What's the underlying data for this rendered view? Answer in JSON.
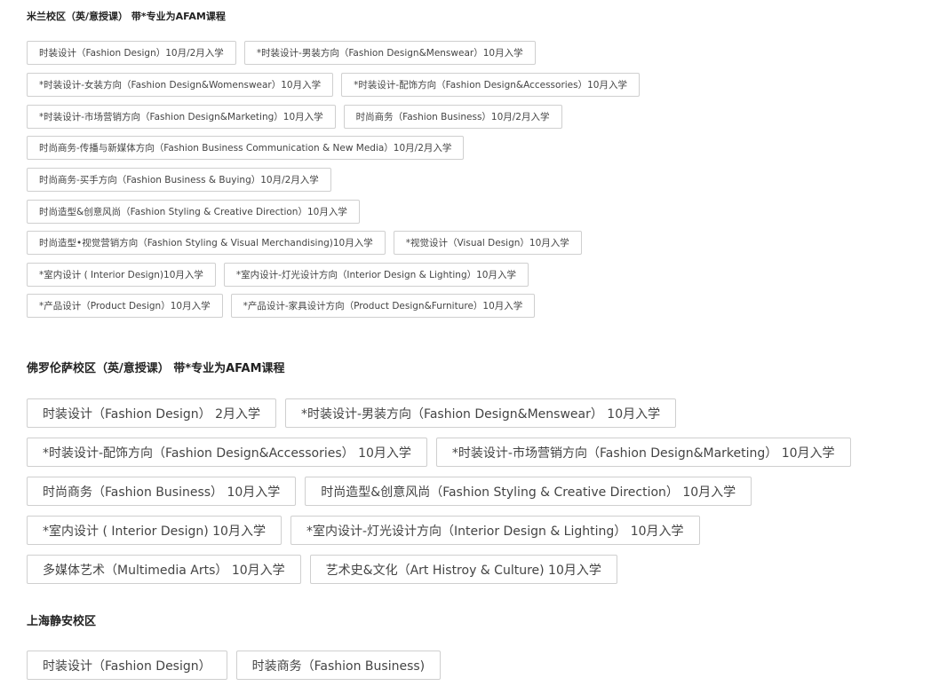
{
  "sections": [
    {
      "title": "米兰校区（英/意授课） 带*专业为AFAM课程",
      "rows": [
        [
          "时装设计（Fashion Design）10月/2月入学",
          "*时装设计-男装方向（Fashion Design&Menswear）10月入学"
        ],
        [
          "*时装设计-女装方向（Fashion Design&Womenswear）10月入学",
          "*时装设计-配饰方向（Fashion Design&Accessories）10月入学"
        ],
        [
          "*时装设计-市场营销方向（Fashion Design&Marketing）10月入学",
          "时尚商务（Fashion Business）10月/2月入学"
        ],
        [
          "时尚商务-传播与新媒体方向（Fashion Business Communication & New Media）10月/2月入学"
        ],
        [
          "时尚商务-买手方向（Fashion Business & Buying）10月/2月入学"
        ],
        [
          "时尚造型&创意风尚（Fashion Styling & Creative Direction）10月入学"
        ],
        [
          "时尚造型•视觉营销方向（Fashion Styling & Visual Merchandising)10月入学",
          "*视觉设计（Visual Design）10月入学"
        ],
        [
          "*室内设计 ( Interior Design)10月入学",
          "*室内设计-灯光设计方向（Interior Design & Lighting）10月入学"
        ],
        [
          "*产品设计（Product Design）10月入学",
          "*产品设计-家具设计方向（Product Design&Furniture）10月入学"
        ]
      ]
    },
    {
      "title": "佛罗伦萨校区（英/意授课） 带*专业为AFAM课程",
      "rows": [
        [
          "时装设计（Fashion Design） 2月入学",
          "*时装设计-男装方向（Fashion Design&Menswear） 10月入学"
        ],
        [
          "*时装设计-配饰方向（Fashion Design&Accessories） 10月入学",
          "*时装设计-市场营销方向（Fashion Design&Marketing） 10月入学"
        ],
        [
          "时尚商务（Fashion Business） 10月入学",
          "时尚造型&创意风尚（Fashion Styling & Creative Direction） 10月入学"
        ],
        [
          "*室内设计 ( Interior Design) 10月入学",
          "*室内设计-灯光设计方向（Interior Design & Lighting） 10月入学"
        ],
        [
          "多媒体艺术（Multimedia Arts） 10月入学",
          "艺术史&文化（Art Histroy & Culture) 10月入学"
        ]
      ]
    },
    {
      "title": "上海静安校区",
      "rows": [
        [
          "时装设计（Fashion Design）",
          "时装商务（Fashion Business)"
        ]
      ]
    }
  ]
}
